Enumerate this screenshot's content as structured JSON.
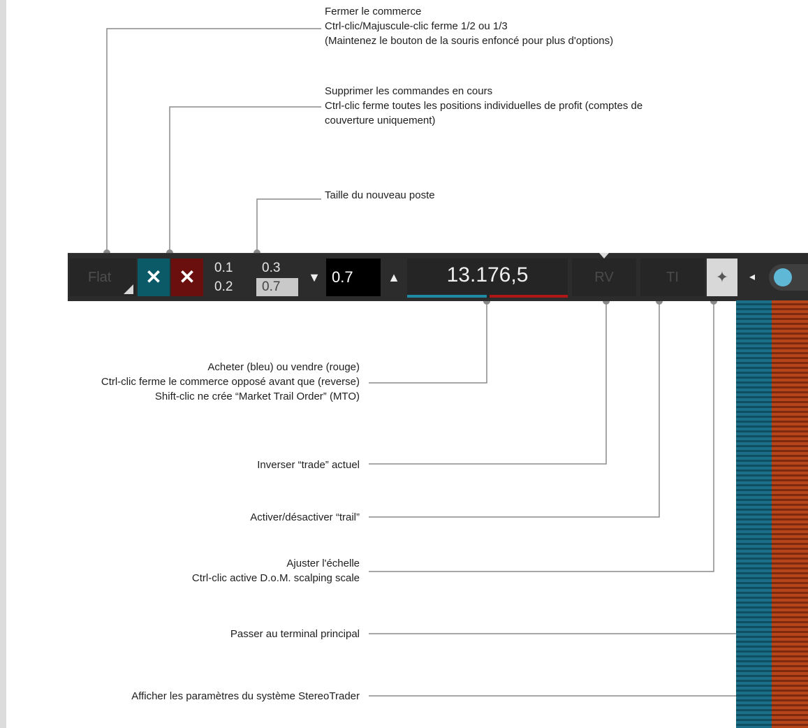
{
  "toolbar": {
    "flat_label": "Flat",
    "close_trade_symbol": "✕",
    "cancel_orders_symbol": "✕",
    "sizes": [
      "0.1",
      "0.3",
      "0.2",
      "0.7"
    ],
    "selected_size": "0.7",
    "stepper_down": "▼",
    "stepper_value": "0.7",
    "stepper_up": "▲",
    "price": "13.176,5",
    "reverse_label": "RV",
    "trail_label": "TI",
    "scale_icon": "✦",
    "switch_arrow": "◂"
  },
  "annotations": {
    "close_trade": [
      "Fermer le commerce",
      "Ctrl-clic/Majuscule-clic ferme 1/2 ou 1/3",
      "(Maintenez le bouton de la souris enfoncé pour plus d'options)"
    ],
    "cancel_orders": [
      "Supprimer les commandes en cours",
      "Ctrl-clic ferme toutes les positions individuelles de profit (comptes de",
      "couverture uniquement)"
    ],
    "position_size": [
      "Taille du nouveau poste"
    ],
    "buy_sell": [
      "Acheter (bleu) ou vendre (rouge)",
      "Ctrl-clic ferme le commerce opposé avant que (reverse)",
      "Shift-clic ne crée “Market Trail Order” (MTO)"
    ],
    "reverse": [
      "Inverser “trade” actuel"
    ],
    "trail": [
      "Activer/désactiver “trail”"
    ],
    "scale": [
      "Ajuster l'échelle",
      "Ctrl-clic active D.o.M. scalping scale"
    ],
    "terminal": [
      "Passer au terminal principal"
    ],
    "settings": [
      "Afficher les paramètres du système StereoTrader"
    ]
  },
  "colors": {
    "buy": "#0b5a67",
    "sell": "#6a0e0e",
    "toolbar_bg": "#2c2c2c",
    "connector": "#8a8a8a"
  }
}
